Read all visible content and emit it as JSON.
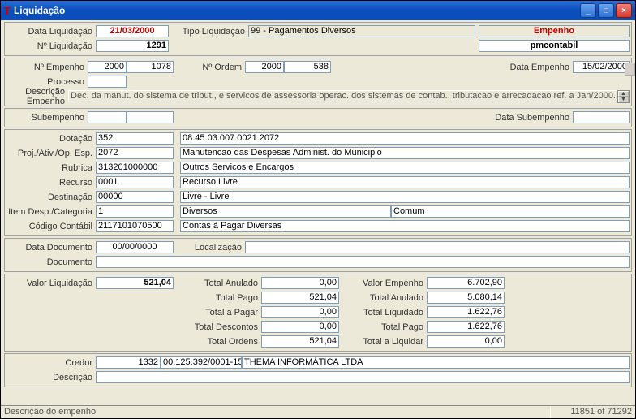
{
  "window": {
    "title": "Liquidação"
  },
  "header": {
    "data_liquidacao_label": "Data Liquidação",
    "data_liquidacao": "21/03/2000",
    "tipo_label": "Tipo Liquidação",
    "tipo": "99 - Pagamentos Diversos",
    "empenho_label": "Empenho",
    "nro_liquidacao_label": "Nº Liquidação",
    "nro_liquidacao": "1291",
    "user": "pmcontabil"
  },
  "empenho": {
    "nro_empenho_label": "Nº Empenho",
    "nro_empenho_a": "2000",
    "nro_empenho_b": "1078",
    "nro_ordem_label": "Nº Ordem",
    "nro_ordem_a": "2000",
    "nro_ordem_b": "538",
    "data_empenho_label": "Data Empenho",
    "data_empenho": "15/02/2000",
    "processo_label": "Processo",
    "descricao_label": "Descrição Empenho",
    "descricao": "Dec. da manut. do sistema de tribut., e servicos de assessoria operac. dos sistemas de contab., tributacao e arrecadacao ref. a Jan/2000."
  },
  "subempenho": {
    "label": "Subempenho",
    "data_label": "Data Subempenho"
  },
  "dotacao": {
    "dotacao_label": "Dotação",
    "dotacao_a": "352",
    "dotacao_b": "08.45.03.007.0021.2072",
    "proj_label": "Proj./Ativ./Op. Esp.",
    "proj_a": "2072",
    "proj_b": "Manutencao das Despesas Administ. do Municipio",
    "rubrica_label": "Rubrica",
    "rubrica_a": "313201000000",
    "rubrica_b": "Outros Servicos e Encargos",
    "recurso_label": "Recurso",
    "recurso_a": "0001",
    "recurso_b": "Recurso Livre",
    "destinacao_label": "Destinação",
    "destinacao_a": "00000",
    "destinacao_b": "Livre - Livre",
    "item_label": "Item Desp./Categoria",
    "item_a": "1",
    "item_b": "Diversos",
    "item_c": "Comum",
    "codigo_label": "Código Contábil",
    "codigo_a": "2117101070500",
    "codigo_b": "Contas à Pagar Diversas"
  },
  "documento": {
    "data_doc_label": "Data Documento",
    "data_doc": "00/00/0000",
    "localizacao_label": "Localização",
    "documento_label": "Documento"
  },
  "totais": {
    "valor_liq_label": "Valor Liquidação",
    "valor_liq": "521,04",
    "total_anulado_label": "Total Anulado",
    "total_anulado": "0,00",
    "total_pago_label": "Total Pago",
    "total_pago": "521,04",
    "total_a_pagar_label": "Total a Pagar",
    "total_a_pagar": "0,00",
    "total_descontos_label": "Total Descontos",
    "total_descontos": "0,00",
    "total_ordens_label": "Total Ordens",
    "total_ordens": "521,04",
    "valor_empenho_label": "Valor Empenho",
    "valor_empenho": "6.702,90",
    "emp_total_anulado_label": "Total Anulado",
    "emp_total_anulado": "5.080,14",
    "emp_total_liquidado_label": "Total Liquidado",
    "emp_total_liquidado": "1.622,76",
    "emp_total_pago_label": "Total Pago",
    "emp_total_pago": "1.622,76",
    "emp_total_a_liquidar_label": "Total a Liquidar",
    "emp_total_a_liquidar": "0,00"
  },
  "credor": {
    "credor_label": "Credor",
    "credor_a": "1332",
    "credor_b": "00.125.392/0001-15",
    "credor_c": "THEMA INFORMÁTICA LTDA",
    "descricao_label": "Descrição"
  },
  "status": {
    "left": "Descrição do empenho",
    "right": "11851 of 71292"
  }
}
